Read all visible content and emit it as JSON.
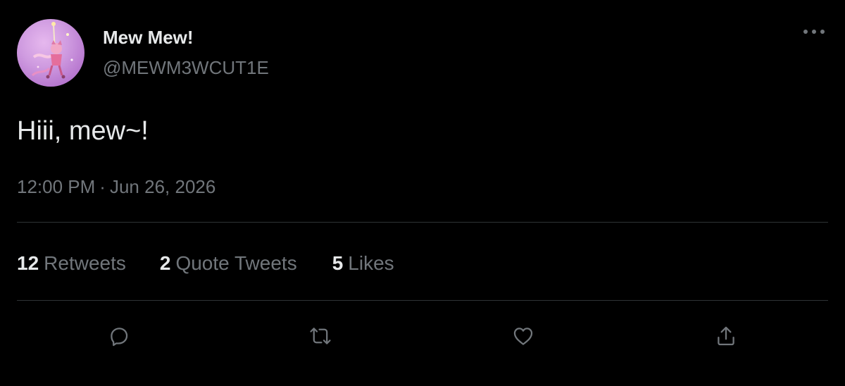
{
  "author": {
    "display_name": "Mew Mew!",
    "handle": "@MEWM3WCUT1E",
    "avatar": "avatar-anime-character"
  },
  "tweet": {
    "text": "Hiii, mew~!",
    "time": "12:00 PM",
    "separator": "·",
    "date": "Jun 26, 2026"
  },
  "stats": {
    "retweets": {
      "count": "12",
      "label": "Retweets"
    },
    "quote_tweets": {
      "count": "2",
      "label": "Quote Tweets"
    },
    "likes": {
      "count": "5",
      "label": "Likes"
    }
  },
  "actions": [
    "reply-icon",
    "retweet-icon",
    "like-icon",
    "share-icon"
  ],
  "more_menu_icon": "more-horizontal-icon",
  "colors": {
    "background": "#000000",
    "primary_text": "#e7e9ea",
    "secondary_text": "#71767b",
    "divider": "#2f3336"
  }
}
